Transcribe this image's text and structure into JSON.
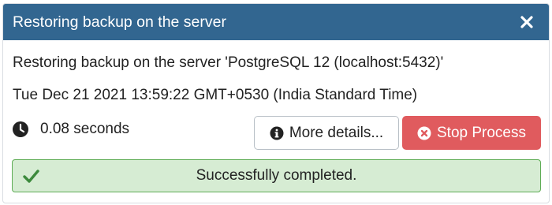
{
  "dialog": {
    "title": "Restoring backup on the server",
    "description": "Restoring backup on the server 'PostgreSQL 12 (localhost:5432)'",
    "timestamp": "Tue Dec 21 2021 13:59:22 GMT+0530 (India Standard Time)",
    "elapsed": "0.08 seconds",
    "more_details_label": "More details...",
    "stop_label": "Stop Process",
    "status_message": "Successfully completed."
  },
  "colors": {
    "header": "#326690",
    "stop_button": "#e05b5e",
    "success_bg": "#d6ecd3",
    "success_border": "#5fad56",
    "success_icon": "#3c8a3c"
  },
  "icons": {
    "close": "close-icon",
    "clock": "clock-icon",
    "info": "info-icon",
    "stop": "stop-circle-icon",
    "check": "check-icon"
  }
}
